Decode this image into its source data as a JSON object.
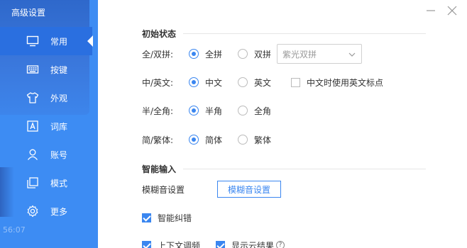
{
  "app": {
    "title": "高级设置",
    "timestamp": "56:07"
  },
  "sidebar": {
    "items": [
      {
        "label": "常用",
        "icon": "monitor-icon",
        "active": true
      },
      {
        "label": "按键",
        "icon": "keyboard-icon",
        "active": false
      },
      {
        "label": "外观",
        "icon": "tshirt-icon",
        "active": false
      },
      {
        "label": "词库",
        "icon": "dictionary-icon",
        "active": false
      },
      {
        "label": "账号",
        "icon": "user-icon",
        "active": false
      },
      {
        "label": "模式",
        "icon": "mode-icon",
        "active": false
      },
      {
        "label": "更多",
        "icon": "gear-icon",
        "active": false
      }
    ]
  },
  "window": {
    "minimize_icon": "minimize-icon",
    "close_icon": "close-icon"
  },
  "initial_state": {
    "title": "初始状态",
    "pinyin": {
      "label": "全/双拼:",
      "opt1": "全拼",
      "opt2": "双拼",
      "selected": "全拼",
      "scheme_placeholder": "紫光双拼"
    },
    "lang": {
      "label": "中/英文:",
      "opt1": "中文",
      "opt2": "英文",
      "selected": "中文",
      "extra_label": "中文时使用英文标点",
      "extra_checked": false
    },
    "width": {
      "label": "半/全角:",
      "opt1": "半角",
      "opt2": "全角",
      "selected": "半角"
    },
    "script": {
      "label": "简/繁体:",
      "opt1": "简体",
      "opt2": "繁体",
      "selected": "简体"
    }
  },
  "smart_input": {
    "title": "智能输入",
    "fuzzy_label": "模糊音设置",
    "fuzzy_button": "模糊音设置",
    "autocorrect": {
      "label": "智能纠错",
      "checked": true
    },
    "context": {
      "label": "上下文调频",
      "checked": true
    },
    "cloud": {
      "label": "显示云结果",
      "checked": true,
      "help": "?"
    }
  },
  "colors": {
    "sidebar": "#3d8cf3",
    "accent": "#3a86f0"
  }
}
